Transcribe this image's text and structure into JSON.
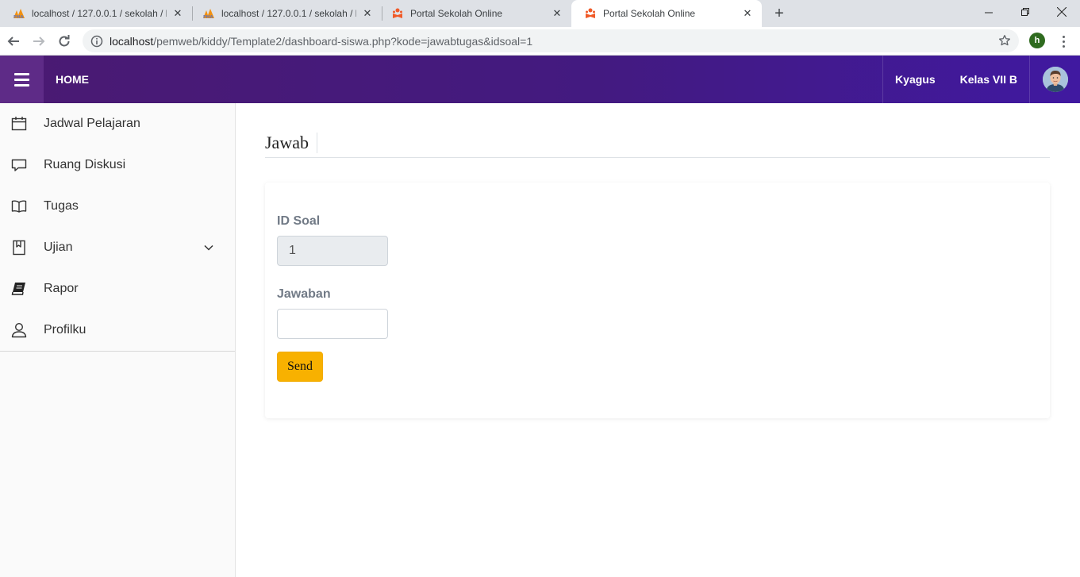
{
  "browser": {
    "tabs": [
      {
        "title": "localhost / 127.0.0.1 / sekolah / b",
        "favicon": "phpmyadmin-icon",
        "active": false
      },
      {
        "title": "localhost / 127.0.0.1 / sekolah / b",
        "favicon": "phpmyadmin-icon",
        "active": false
      },
      {
        "title": "Portal Sekolah Online",
        "favicon": "school-icon",
        "active": false
      },
      {
        "title": "Portal Sekolah Online",
        "favicon": "school-icon",
        "active": true
      }
    ],
    "url_host": "localhost",
    "url_path": "/pemweb/kiddy/Template2/dashboard-siswa.php?kode=jawabtugas&idsoal=1",
    "profile_initial": "h"
  },
  "header": {
    "home_label": "HOME",
    "user_name": "Kyagus",
    "class_name": "Kelas VII B",
    "accent_color": "#431a80"
  },
  "sidebar": {
    "items": [
      {
        "label": "Jadwal Pelajaran",
        "icon": "calendar-icon"
      },
      {
        "label": "Ruang Diskusi",
        "icon": "chat-icon"
      },
      {
        "label": "Tugas",
        "icon": "open-book-icon"
      },
      {
        "label": "Ujian",
        "icon": "bookmark-book-icon",
        "has_submenu": true
      },
      {
        "label": "Rapor",
        "icon": "book-icon"
      },
      {
        "label": "Profilku",
        "icon": "user-icon"
      }
    ]
  },
  "page": {
    "title": "Jawab",
    "form": {
      "id_soal_label": "ID Soal",
      "id_soal_value": "1",
      "jawaban_label": "Jawaban",
      "jawaban_value": "",
      "send_label": "Send",
      "send_color": "#f8b100"
    }
  }
}
